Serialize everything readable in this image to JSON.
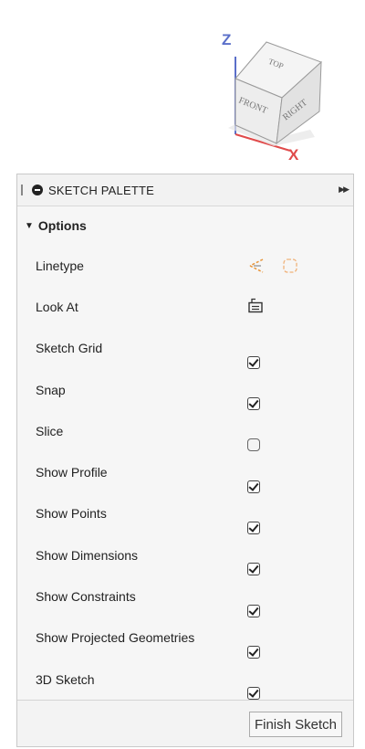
{
  "viewcube": {
    "axis_z": "Z",
    "axis_x": "X",
    "face_top": "TOP",
    "face_front": "FRONT",
    "face_right": "RIGHT"
  },
  "palette": {
    "title": "SKETCH PALETTE",
    "section": "Options",
    "rows": [
      {
        "label": "Linetype",
        "control": "linetype-icons"
      },
      {
        "label": "Look At",
        "control": "look-at-icon"
      },
      {
        "label": "Sketch Grid",
        "control": "checkbox",
        "checked": true
      },
      {
        "label": "Snap",
        "control": "checkbox",
        "checked": true
      },
      {
        "label": "Slice",
        "control": "checkbox",
        "checked": false
      },
      {
        "label": "Show Profile",
        "control": "checkbox",
        "checked": true
      },
      {
        "label": "Show Points",
        "control": "checkbox",
        "checked": true
      },
      {
        "label": "Show Dimensions",
        "control": "checkbox",
        "checked": true
      },
      {
        "label": "Show Constraints",
        "control": "checkbox",
        "checked": true
      },
      {
        "label": "Show Projected Geometries",
        "control": "checkbox",
        "checked": true
      },
      {
        "label": "3D Sketch",
        "control": "checkbox",
        "checked": true
      }
    ],
    "finish_label": "Finish Sketch"
  },
  "colors": {
    "axis_z": "#5a6fc9",
    "axis_x": "#e04a4a",
    "linetype_accent": "#e8953a"
  },
  "icons": {
    "linetype_construction": "construction-line-icon",
    "linetype_centerline": "centerline-icon",
    "look_at": "look-at-icon",
    "expand": "double-chevron-right-icon",
    "hide": "minus-circle-icon",
    "collapse": "triangle-down-icon"
  }
}
